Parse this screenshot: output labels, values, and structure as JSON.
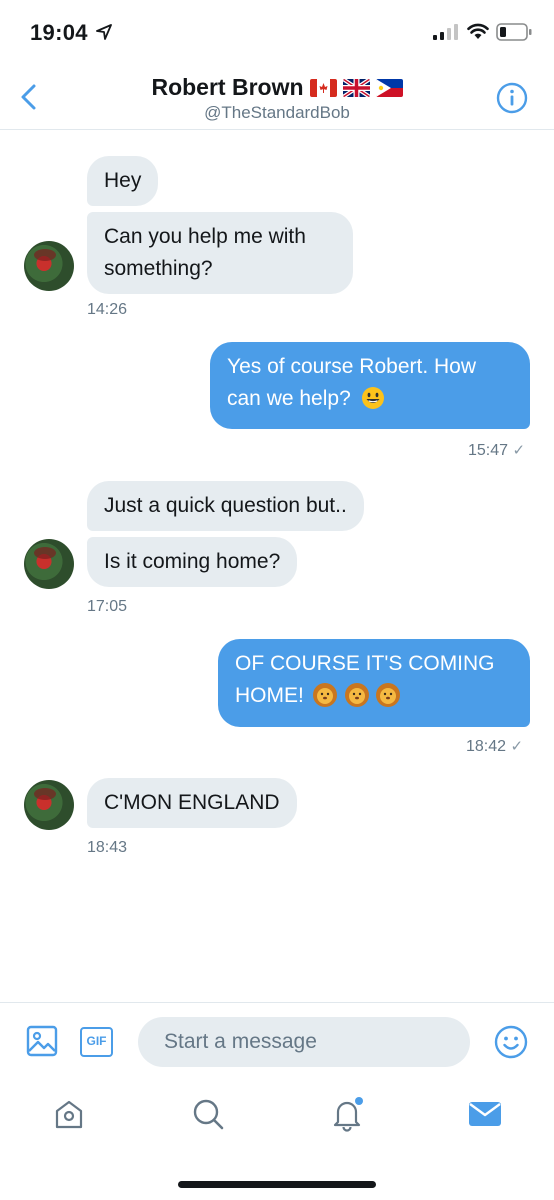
{
  "status_bar": {
    "time": "19:04",
    "icons": [
      "location-arrow-icon",
      "signal-icon",
      "wifi-icon",
      "battery-icon"
    ]
  },
  "header": {
    "name": "Robert Brown",
    "flags": [
      "canada-flag",
      "uk-flag",
      "philippines-flag"
    ],
    "handle": "@TheStandardBob",
    "back_icon": "chevron-left-icon",
    "info_icon": "info-icon"
  },
  "messages": [
    {
      "direction": "incoming",
      "bubbles": [
        "Hey",
        "Can you help me with something?"
      ],
      "time": "14:26"
    },
    {
      "direction": "outgoing",
      "text": "Yes of course Robert. How can we help?",
      "emoji": [
        "smiley-emoji"
      ],
      "time": "15:47",
      "status_icon": "check-icon"
    },
    {
      "direction": "incoming",
      "bubbles": [
        "Just a quick question but..",
        "Is it coming home?"
      ],
      "time": "17:05"
    },
    {
      "direction": "outgoing",
      "text": "OF COURSE IT'S COMING HOME!",
      "emoji": [
        "lion-emoji",
        "lion-emoji",
        "lion-emoji"
      ],
      "time": "18:42",
      "status_icon": "check-icon"
    },
    {
      "direction": "incoming",
      "bubbles": [
        "C'MON ENGLAND"
      ],
      "time": "18:43"
    }
  ],
  "composer": {
    "image_icon": "image-icon",
    "gif_label": "GIF",
    "placeholder": "Start a message",
    "emoji_icon": "emoji-icon"
  },
  "tabbar": {
    "tabs": [
      {
        "icon": "home-icon",
        "active": false
      },
      {
        "icon": "search-icon",
        "active": false
      },
      {
        "icon": "bell-icon",
        "active": false,
        "has_notification_dot": true
      },
      {
        "icon": "mail-icon",
        "active": true
      }
    ]
  },
  "colors": {
    "accent": "#4b9de8",
    "incoming_bubble": "#e6ecf0",
    "secondary_text": "#657786"
  }
}
